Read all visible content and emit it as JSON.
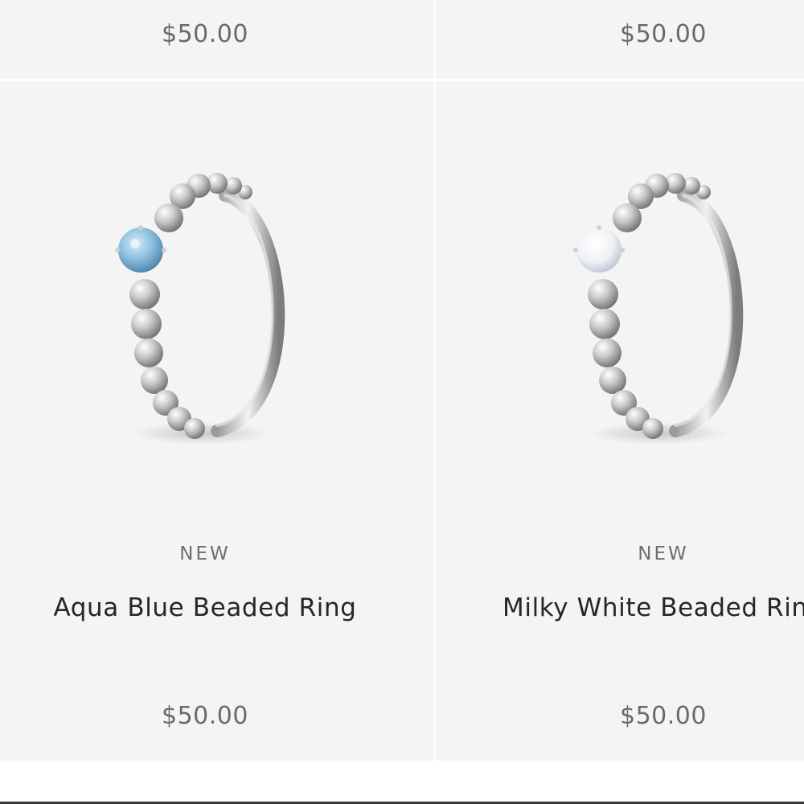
{
  "top_row": {
    "left_price": "$50.00",
    "right_price": "$50.00"
  },
  "products": [
    {
      "badge": "NEW",
      "name": "Aqua Blue Beaded Ring",
      "price": "$50.00",
      "stone_color": "#8ec0e0"
    },
    {
      "badge": "NEW",
      "name": "Milky White Beaded Ring",
      "price": "$50.00",
      "stone_color": "#eef1f5"
    }
  ],
  "colors": {
    "card_background": "#f4f4f4",
    "price_text": "#6a6a6a",
    "name_text": "#262626"
  }
}
